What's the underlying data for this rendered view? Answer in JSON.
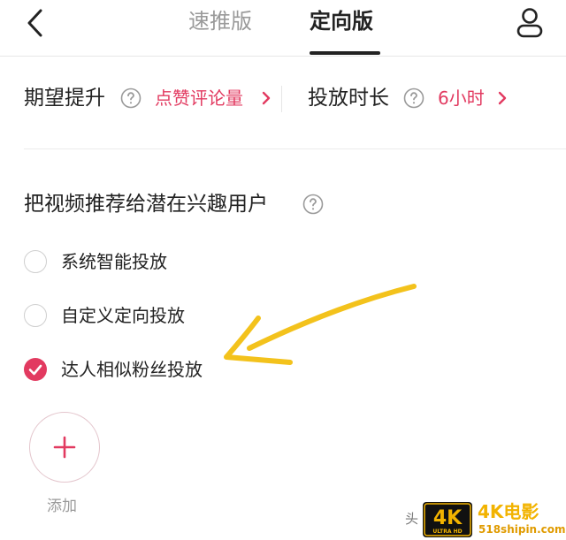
{
  "header": {
    "tabs": [
      {
        "label": "速推版",
        "active": false
      },
      {
        "label": "定向版",
        "active": true
      }
    ],
    "icons": {
      "back": "chevron-left-icon",
      "user": "user-icon"
    }
  },
  "settings": {
    "expect_label": "期望提升",
    "expect_value": "点赞评论量",
    "duration_label": "投放时长",
    "duration_value": "6小时"
  },
  "recommend": {
    "title": "把视频推荐给潜在兴趣用户",
    "options": [
      {
        "label": "系统智能投放",
        "checked": false
      },
      {
        "label": "自定义定向投放",
        "checked": false
      },
      {
        "label": "达人相似粉丝投放",
        "checked": true
      }
    ]
  },
  "add": {
    "label": "添加"
  },
  "watermark": {
    "prefix": "头",
    "logo_big": "4K",
    "logo_small": "ULTRA HD",
    "brand": "4K电影",
    "url": "518shipin.com"
  },
  "colors": {
    "accent": "#e23a60",
    "annotation": "#f3c21c",
    "text": "#222222",
    "muted": "#9a9a9a"
  }
}
